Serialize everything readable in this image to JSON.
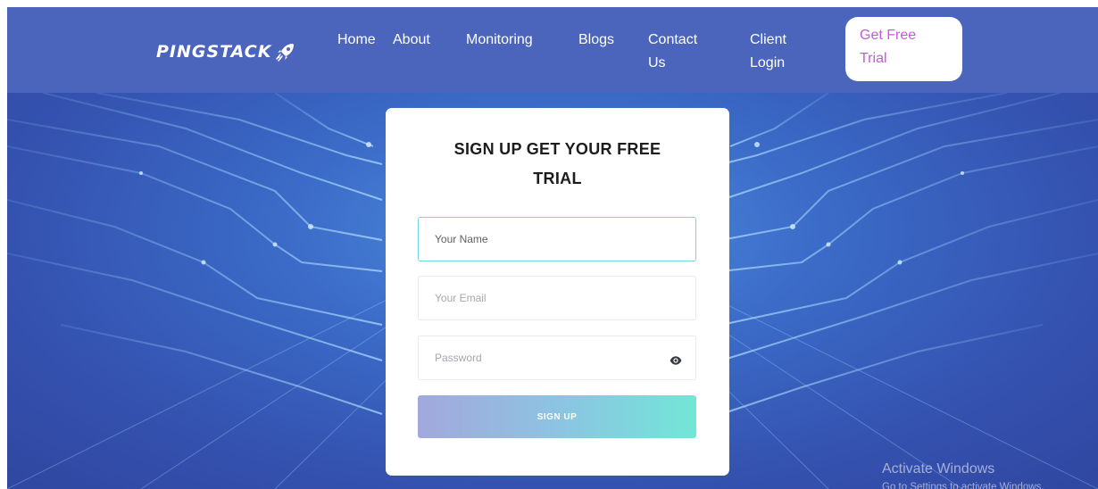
{
  "brand": {
    "name": "PINGSTACK",
    "logo_icon": "rocket-icon"
  },
  "nav": {
    "items": [
      {
        "label": "Home"
      },
      {
        "label": "About"
      },
      {
        "label": "Monitoring"
      },
      {
        "label": "Blogs"
      },
      {
        "label_line1": "Contact",
        "label_line2": "Us"
      },
      {
        "label_line1": "Client",
        "label_line2": "Login"
      }
    ],
    "cta": {
      "label_line1": "Get Free",
      "label_line2": "Trial"
    }
  },
  "signup": {
    "title_line1": "SIGN UP GET YOUR FREE",
    "title_line2": "TRIAL",
    "name_placeholder": "Your Name",
    "email_placeholder": "Your Email",
    "password_placeholder": "Password",
    "password_toggle_icon": "eye-icon",
    "submit_label": "SIGN UP"
  },
  "watermark": {
    "title": "Activate Windows",
    "subtitle": "Go to Settings to activate Windows."
  },
  "colors": {
    "navbar": "#4b65bd",
    "cta_text": "#c25bd8",
    "button_gradient_start": "#a3a8dc",
    "button_gradient_end": "#72e6d6",
    "focus_border": "#76d7e0"
  }
}
